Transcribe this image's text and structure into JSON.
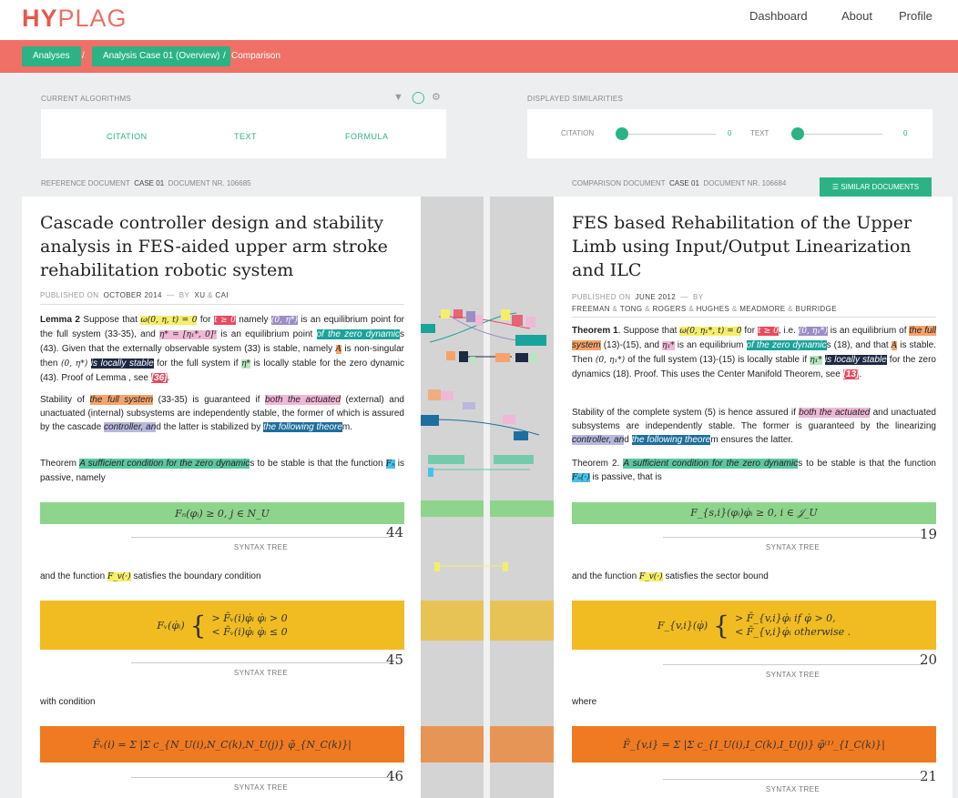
{
  "logo": {
    "part1": "HY",
    "part2": "PLAG"
  },
  "nav": {
    "dashboard": "Dashboard",
    "about": "About",
    "profile": "Profile"
  },
  "breadcrumb": {
    "analyses": "Analyses",
    "sep1": "/",
    "case": "Analysis Case 01 (Overview)",
    "sep2": "/",
    "current": "Comparison"
  },
  "algorithms": {
    "section_label": "CURRENT ALGORITHMS",
    "items": [
      "CITATION",
      "TEXT",
      "FORMULA"
    ],
    "filter_icon": "filter-icon",
    "circle_icon": "circle-icon",
    "gear_icon": "gear-icon"
  },
  "similarities": {
    "section_label": "DISPLAYED SIMILARITIES",
    "citation_label": "CITATION",
    "citation_value": "0",
    "text_label": "TEXT",
    "text_value": "0"
  },
  "reference": {
    "meta_label": "REFERENCE DOCUMENT",
    "case": "CASE 01",
    "doc_label": "DOCUMENT NR.",
    "doc_nr": "106685",
    "title": "Cascade controller design and stability analysis in FES-aided upper arm stroke rehabilitation robotic system",
    "published_label": "PUBLISHED ON",
    "date": "OCTOBER 2014",
    "by": "BY",
    "authors": [
      "XU",
      "CAI"
    ],
    "amp": "&",
    "para1": {
      "lemma": "Lemma 2",
      "t1": " Suppose that ",
      "m1": "ω(0, η, t) = 0",
      "t2": " for ",
      "m2": "t ≥ 0",
      "t3": " namely ",
      "m3": "(0, η*)",
      "t4": " is an equilibrium point for the full system (33-35), and ",
      "m4": "η* = [η₁*, 0]ᵀ",
      "t5": " is an equilibrium point ",
      "h1": "of the zero dynamic",
      "t6": "s (43). Given that the externally observable system (33) is stable, namely ",
      "m5": "A",
      "t7": " is non-singular then ",
      "m6": "(0, η*)",
      "t8": " ",
      "h2": "is locally stable",
      "t9": " for the full system if ",
      "m7": "η*",
      "t10": " is locally stable for the zero dynamic (43). Proof of Lemma , see ",
      "ref": "[36]",
      "t11": "."
    },
    "para2": {
      "t1": "Stability of ",
      "h1": "the full system",
      "t2": " (33-35) is guaranteed if ",
      "h2": "both the actuated",
      "t3": " (external) and unactuated (internal) subsystems are independently stable, the former of which is assured by the cascade ",
      "h3": "controller, an",
      "t4": "d the latter is stabilized by ",
      "h4": "the following theore",
      "t5": "m."
    },
    "para3": {
      "t1": "Theorem ",
      "h1": "A sufficient condition for the zero dynamic",
      "t2": "s to be stable is that the function ",
      "m1": "Fₙ",
      "t3": " is passive, namely"
    },
    "formula44": "Fₙ(φᵢ) ≥ 0, j ∈ N_U",
    "num44": "44",
    "syntax": "SYNTAX TREE",
    "para4": {
      "t1": "and the function ",
      "m1": "F_v(·)",
      "t2": " satisfies the boundary condition"
    },
    "formula45a": "> F̄ᵥ(i)φ̇ᵢ    φ̇ᵢ > 0",
    "formula45b": "< F̄ᵥ(i)φ̇ᵢ    φ̇ᵢ ≤ 0",
    "formula45_lhs": "Fᵥ(φ̇ᵢ)",
    "num45": "45",
    "para5": "with condition",
    "formula46": "F̄ᵥ(i) = Σ |Σ c_{N_U(i),N_C(k),N_U(j)} φ̃_{N_C(k)}|",
    "num46": "46"
  },
  "comparison": {
    "meta_label": "COMPARISON DOCUMENT",
    "case": "CASE 01",
    "doc_label": "DOCUMENT NR.",
    "doc_nr": "106684",
    "similar_button": "☰ SIMILAR DOCUMENTS",
    "title": "FES based Rehabilitation of the Upper Limb using Input/Output Linearization and ILC",
    "published_label": "PUBLISHED ON",
    "date": "JUNE 2012",
    "by": "BY",
    "authors": [
      "FREEMAN",
      "TONG",
      "ROGERS",
      "HUGHES",
      "MEADMORE",
      "BURRIDGE"
    ],
    "amp": "&",
    "para1": {
      "theorem": "Theorem 1",
      "t1": ". Suppose that ",
      "m1": "ω(0, η₁*, t) = 0",
      "t2": " for ",
      "m2": "t ≥ 0",
      "t3": ", i.e. ",
      "m3": "(0, η₁*)",
      "t4": " is an equilibrium of ",
      "h1": "the full system",
      "t5": " (13)-(15), and ",
      "m4": "η₁*",
      "t6": " is an equilibrium ",
      "h2": "of the zero dynamic",
      "t7": "s (18), and that ",
      "m5": "A",
      "t8": " is stable. Then ",
      "m6": "(0, η₁*)",
      "t9": " of the full system (13)-(15) is locally stable if ",
      "m7": "η₁*",
      "t10": " ",
      "h3": "is locally stable",
      "t11": " for the zero dynamics (18). Proof. This uses the Center Manifold Theorem, see ",
      "ref": "[13]",
      "t12": "."
    },
    "para2": {
      "t1": "Stability of the complete system (5) is hence assured if ",
      "h1": "both the actuated",
      "t2": " and unactuated subsystems are independently stable. The former is guaranteed by the linearizing ",
      "h2": "controller, an",
      "t3": "d ",
      "h3": "the following theore",
      "t4": "m ensures the latter."
    },
    "para3": {
      "t1": "Theorem 2. ",
      "h1": "A sufficient condition for the zero dynamic",
      "t2": "s to be stable is that the function ",
      "m1": "Fₙ(·)",
      "t3": " is passive, that is"
    },
    "formula19": "F_{s,i}(φᵢ)φ̇ᵢ ≥ 0,  i ∈ 𝒥_U",
    "num19": "19",
    "syntax": "SYNTAX TREE",
    "para4": {
      "t1": "and the function ",
      "m1": "F_v(·)",
      "t2": " satisfies the sector bound"
    },
    "formula20_lhs": "F_{v,i}(φ̇)",
    "formula20a": "> F̄_{v,i}φ̇ᵢ  if φ̇ > 0,",
    "formula20b": "< F̄_{v,i}φ̇ᵢ  otherwise .",
    "num20": "20",
    "para5": "where",
    "formula21": "F̄_{v,i} = Σ |Σ c_{I_U(i),I_C(k),I_U(j)} φ̃⁽¹⁾_{I_C(k)}|",
    "num21": "21"
  },
  "colors": {
    "accent": "#2bb385",
    "brand": "#f07068",
    "formula_green": "#8ed48c",
    "formula_yellow": "#f0bc21",
    "formula_orange": "#f07a21"
  }
}
